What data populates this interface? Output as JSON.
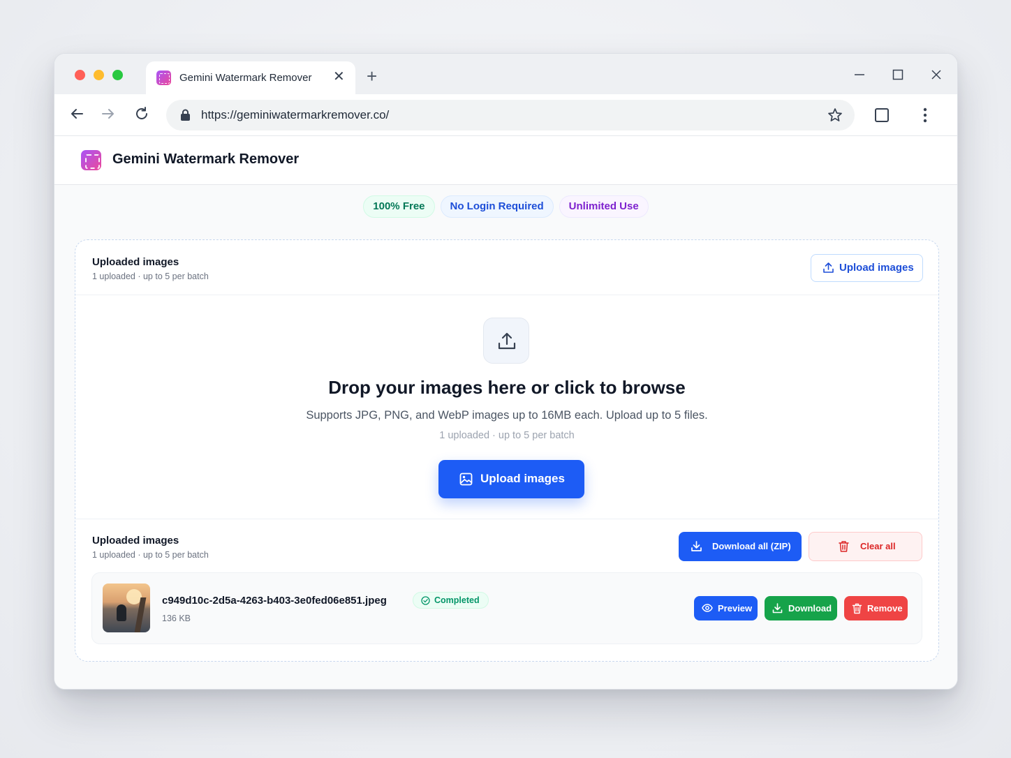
{
  "browser": {
    "tab_title": "Gemini Watermark Remover",
    "url": "https://geminiwatermarkremover.co/",
    "icons": [
      "back-icon",
      "forward-icon",
      "reload-icon",
      "lock-icon",
      "star-icon",
      "sidepanel-icon",
      "kebab-menu-icon",
      "minimize-icon",
      "maximize-icon",
      "close-icon"
    ]
  },
  "app": {
    "title": "Gemini Watermark Remover"
  },
  "badges": {
    "free": "100% Free",
    "login": "No Login Required",
    "unlimited": "Unlimited Use"
  },
  "uploader": {
    "title": "Uploaded images",
    "subtitle": "1 uploaded · up to 5 per batch",
    "upload_button": "Upload images"
  },
  "dropzone": {
    "title": "Drop your images here or click to browse",
    "description": "Supports JPG, PNG, and WebP images up to 16MB each. Upload up to 5 files.",
    "meta": "1 uploaded · up to 5 per batch",
    "button": "Upload images"
  },
  "list": {
    "title": "Uploaded images",
    "subtitle": "1 uploaded · up to 5 per batch",
    "download_all": "Download all (ZIP)",
    "clear_all": "Clear all",
    "files": [
      {
        "name": "c949d10c-2d5a-4263-b403-3e0fed06e851.jpeg",
        "size": "136 KB",
        "status": "Completed",
        "preview": "Preview",
        "download": "Download",
        "remove": "Remove"
      }
    ]
  },
  "colors": {
    "primary": "#1d5cf5",
    "success": "#16a34a",
    "danger": "#ef4444",
    "brand_gradient_start": "#a855f7",
    "brand_gradient_end": "#ec4899"
  }
}
